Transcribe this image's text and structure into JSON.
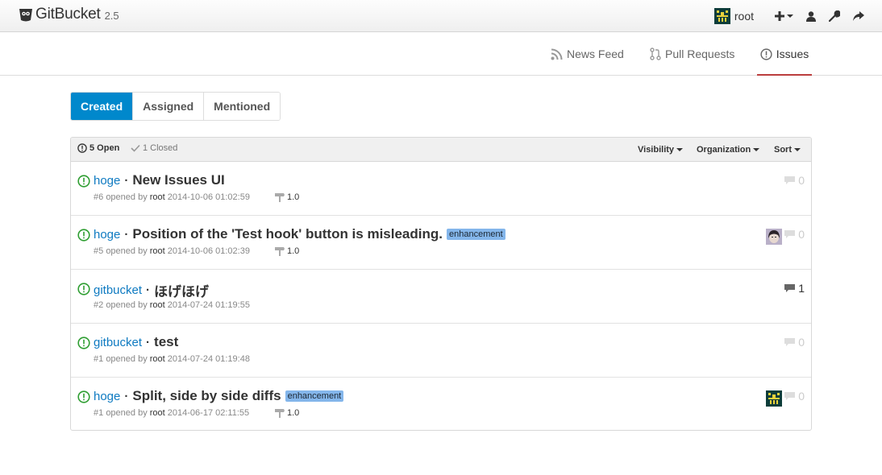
{
  "header": {
    "brand": "GitBucket",
    "version": "2.5",
    "user": "root"
  },
  "subnav": {
    "news_feed": "News Feed",
    "pull_requests": "Pull Requests",
    "issues": "Issues"
  },
  "filters": {
    "created": "Created",
    "assigned": "Assigned",
    "mentioned": "Mentioned"
  },
  "list_header": {
    "open": "5 Open",
    "closed": "1 Closed",
    "visibility": "Visibility",
    "organization": "Organization",
    "sort": "Sort"
  },
  "issues": [
    {
      "repo": "hoge",
      "title": "New Issues UI",
      "label": "",
      "number": "#6",
      "opened_by": "opened by",
      "user": "root",
      "date": "2014-10-06 01:02:59",
      "milestone": "1.0",
      "comments": "0",
      "assignee": ""
    },
    {
      "repo": "hoge",
      "title": "Position of the 'Test hook' button is misleading.",
      "label": "enhancement",
      "number": "#5",
      "opened_by": "opened by",
      "user": "root",
      "date": "2014-10-06 01:02:39",
      "milestone": "1.0",
      "comments": "0",
      "assignee": "photo-avatar"
    },
    {
      "repo": "gitbucket",
      "title": "ほげほげ",
      "label": "",
      "number": "#2",
      "opened_by": "opened by",
      "user": "root",
      "date": "2014-07-24 01:19:55",
      "milestone": "",
      "comments": "1",
      "assignee": ""
    },
    {
      "repo": "gitbucket",
      "title": "test",
      "label": "",
      "number": "#1",
      "opened_by": "opened by",
      "user": "root",
      "date": "2014-07-24 01:19:48",
      "milestone": "",
      "comments": "0",
      "assignee": ""
    },
    {
      "repo": "hoge",
      "title": "Split, side by side diffs",
      "label": "enhancement",
      "number": "#1",
      "opened_by": "opened by",
      "user": "root",
      "date": "2014-06-17 02:11:55",
      "milestone": "1.0",
      "comments": "0",
      "assignee": "identicon-avatar"
    }
  ],
  "colors": {
    "accent": "#0088cc",
    "link": "#0e7ac1",
    "open_icon": "#2f9e32",
    "label_bg": "#84b6eb",
    "active_tab_underline": "#bb3d3d"
  }
}
